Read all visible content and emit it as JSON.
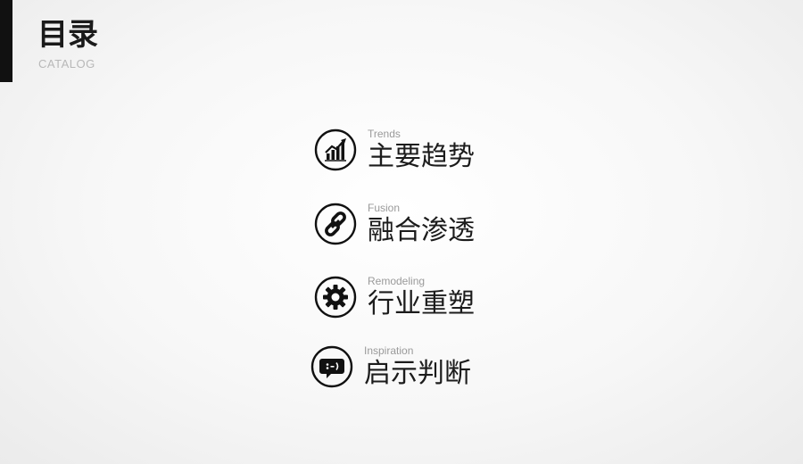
{
  "header": {
    "title": "目录",
    "subtitle": "CATALOG"
  },
  "items": [
    {
      "en": "Trends",
      "cn": "主要趋势",
      "icon": "trend-chart-icon"
    },
    {
      "en": "Fusion",
      "cn": "融合渗透",
      "icon": "chain-link-icon"
    },
    {
      "en": "Remodeling",
      "cn": "行业重塑",
      "icon": "gear-icon"
    },
    {
      "en": "Inspiration",
      "cn": "启示判断",
      "icon": "speech-bubble-icon"
    }
  ],
  "colors": {
    "accent": "#111111",
    "text": "#1c1c1c",
    "muted": "#9a9a9a",
    "subtitle": "#b8b8b8"
  }
}
